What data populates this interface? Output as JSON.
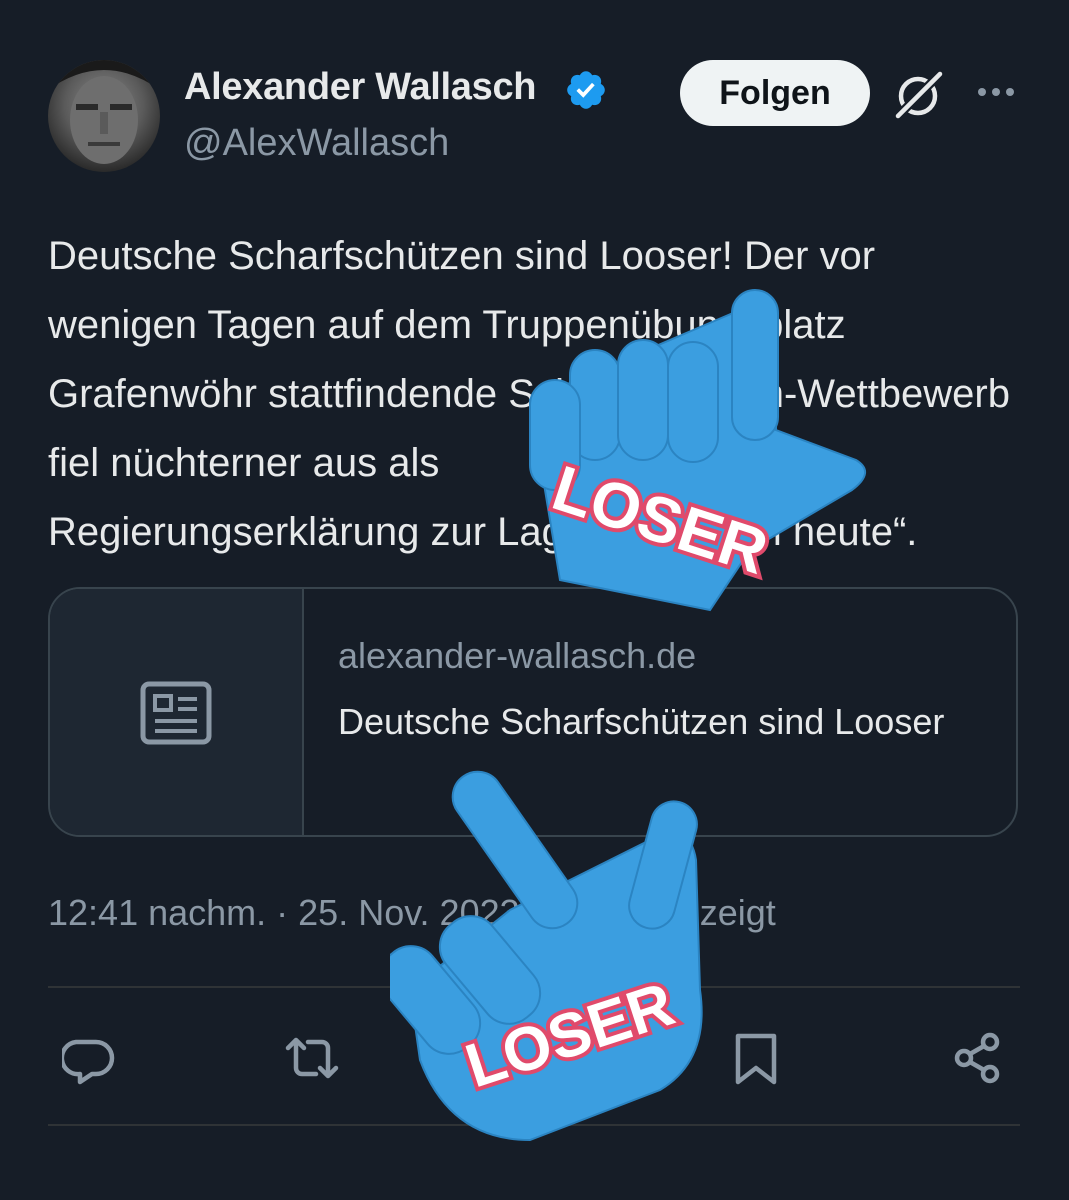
{
  "author": {
    "name": "Alexander Wallasch",
    "handle": "@AlexWallasch",
    "verified_color": "#1d9bf0"
  },
  "header": {
    "follow_label": "Folgen",
    "icons": [
      "grok-icon",
      "more-icon"
    ]
  },
  "tweet": {
    "lines": [
      "Deutsche Scharfschützen sind Looser! Der vor",
      "wenigen Tagen auf dem Truppenübungsplatz",
      "Grafenwöhr stattfindende Scharfschützen-Wettbewerb",
      "fiel nüchterner aus als",
      "Regierungserklärung zur Lage der Nation heute“."
    ]
  },
  "card": {
    "domain": "alexander-wallasch.de",
    "title": "Deutsche Scharfschützen sind Looser",
    "icon": "article-icon"
  },
  "meta": {
    "time": "12:41 nachm.",
    "separator": " · ",
    "date": "25. Nov. 2023",
    "separator2": " · ",
    "views": "Mal angezeigt"
  },
  "actions": [
    "reply-icon",
    "retweet-icon",
    "like-icon",
    "bookmark-icon",
    "share-icon"
  ],
  "overlay": {
    "sticker_text": "LOSER",
    "glove_color": "#3b9ee0",
    "label_color": "#e04a6b"
  }
}
